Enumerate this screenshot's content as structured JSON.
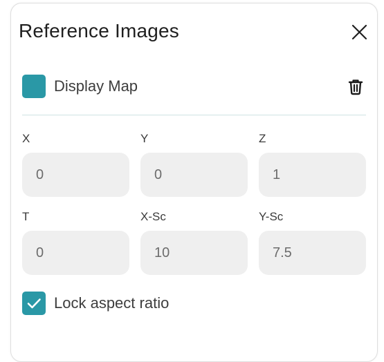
{
  "panel": {
    "title": "Reference Images",
    "close_icon": "close-icon",
    "display_map": {
      "label": "Display Map",
      "checked": true,
      "color": "#2a98a6"
    },
    "delete_icon": "trash-icon"
  },
  "fields": [
    {
      "label": "X",
      "value": "0"
    },
    {
      "label": "Y",
      "value": "0"
    },
    {
      "label": "Z",
      "value": "1"
    },
    {
      "label": "T",
      "value": "0"
    },
    {
      "label": "X-Sc",
      "value": "10"
    },
    {
      "label": "Y-Sc",
      "value": "7.5"
    }
  ],
  "lock_aspect": {
    "label": "Lock aspect ratio",
    "checked": true,
    "color": "#2a98a6"
  }
}
